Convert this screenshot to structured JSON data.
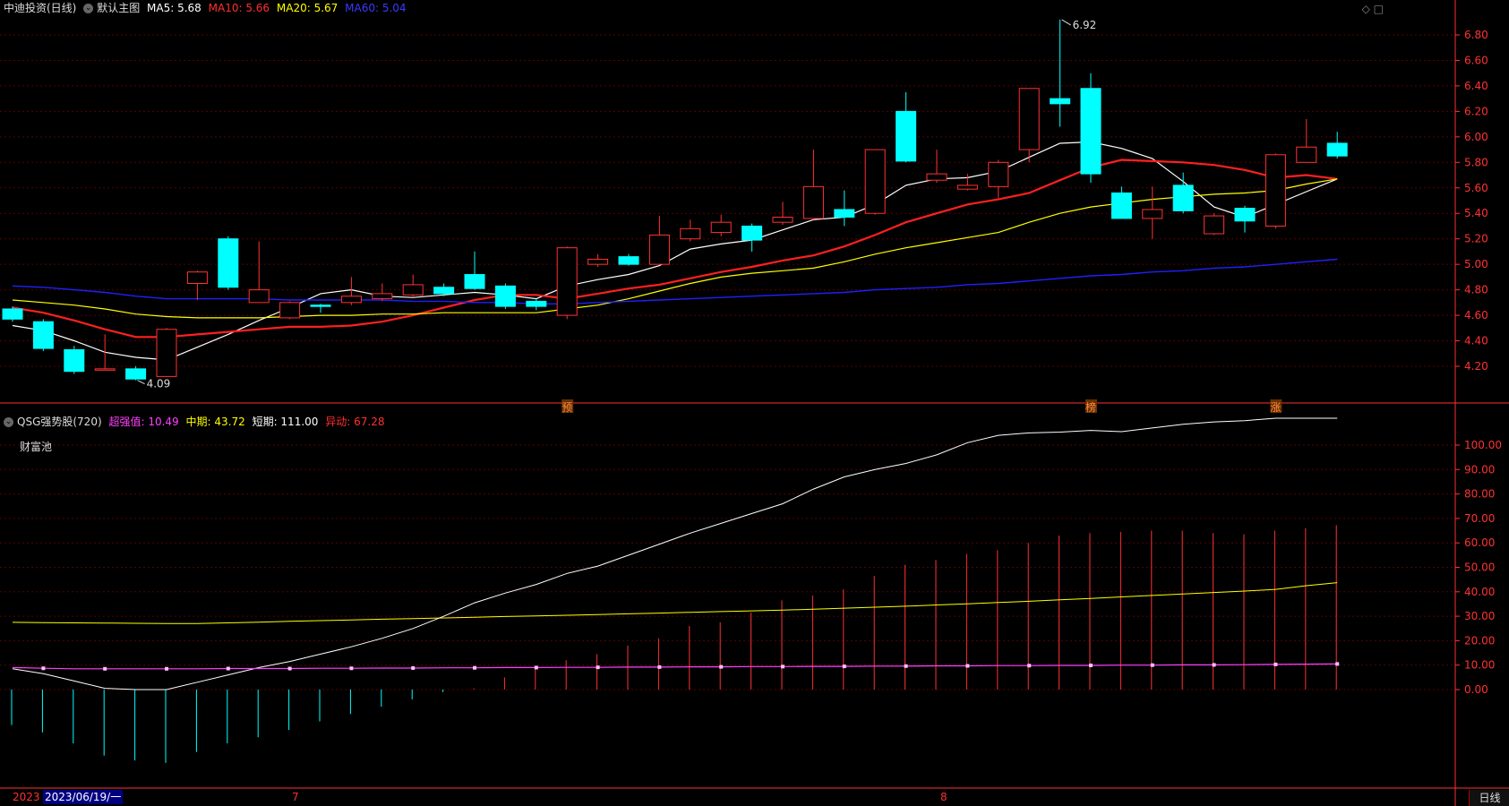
{
  "colors": {
    "up": "#ff3232",
    "down": "#00ffff",
    "ma5": "#ffffff",
    "ma10": "#ff2020",
    "ma20": "#ffff00",
    "ma60": "#2020ff",
    "ind_long": "#ff40ff",
    "ind_mid": "#ffff00",
    "ind_short": "#ffffff",
    "ind_move": "#ff3030",
    "grid": "#5a0000",
    "axis": "#ff3232"
  },
  "header": {
    "stock": "中迪投资(日线)",
    "main_label": "默认主图",
    "ma5": "MA5: 5.68",
    "ma10": "MA10: 5.66",
    "ma20": "MA20: 5.67",
    "ma60": "MA60: 5.04"
  },
  "indicator_header": {
    "name": "QSG强势股(720)",
    "long": "超强值: 10.49",
    "mid": "中期: 43.72",
    "short": "短期: 111.00",
    "move": "异动: 67.28"
  },
  "pool_label": "财富池",
  "period_tab": "日线",
  "date_axis": {
    "year": "2023",
    "cursor": "2023/06/19/一",
    "month7": "7",
    "month8": "8"
  },
  "markers": [
    {
      "text": "预",
      "index": 18
    },
    {
      "text": "榜",
      "index": 35
    },
    {
      "text": "涨",
      "index": 41
    }
  ],
  "annotations": {
    "high": "6.92",
    "low": "4.09"
  },
  "chart_data": [
    {
      "type": "candlestick",
      "title": "中迪投资(日线)",
      "ylim": [
        4.0,
        7.0
      ],
      "ticks": [
        "6.80",
        "6.60",
        "6.40",
        "6.20",
        "6.00",
        "5.80",
        "5.60",
        "5.40",
        "5.20",
        "5.00",
        "4.80",
        "4.60",
        "4.40",
        "4.20"
      ],
      "ohlc": [
        [
          4.65,
          4.67,
          4.55,
          4.57
        ],
        [
          4.55,
          4.57,
          4.32,
          4.34
        ],
        [
          4.33,
          4.36,
          4.14,
          4.16
        ],
        [
          4.18,
          4.45,
          4.18,
          4.18
        ],
        [
          4.18,
          4.2,
          4.09,
          4.1
        ],
        [
          4.12,
          4.5,
          4.12,
          4.49
        ],
        [
          4.85,
          4.95,
          4.72,
          4.94
        ],
        [
          5.2,
          5.22,
          4.8,
          4.82
        ],
        [
          4.7,
          5.18,
          4.7,
          4.8
        ],
        [
          4.58,
          4.71,
          4.57,
          4.7
        ],
        [
          4.68,
          4.69,
          4.62,
          4.67
        ],
        [
          4.7,
          4.9,
          4.68,
          4.75
        ],
        [
          4.73,
          4.85,
          4.71,
          4.77
        ],
        [
          4.76,
          4.92,
          4.74,
          4.84
        ],
        [
          4.82,
          4.85,
          4.75,
          4.77
        ],
        [
          4.92,
          5.1,
          4.8,
          4.81
        ],
        [
          4.83,
          4.85,
          4.65,
          4.67
        ],
        [
          4.71,
          4.73,
          4.64,
          4.67
        ],
        [
          4.6,
          5.14,
          4.57,
          5.13
        ],
        [
          5.0,
          5.08,
          4.98,
          5.04
        ],
        [
          5.06,
          5.08,
          4.99,
          5.0
        ],
        [
          5.0,
          5.38,
          5.0,
          5.23
        ],
        [
          5.2,
          5.35,
          5.18,
          5.28
        ],
        [
          5.25,
          5.39,
          5.22,
          5.33
        ],
        [
          5.3,
          5.32,
          5.1,
          5.19
        ],
        [
          5.33,
          5.49,
          5.31,
          5.37
        ],
        [
          5.36,
          5.9,
          5.35,
          5.61
        ],
        [
          5.43,
          5.58,
          5.3,
          5.37
        ],
        [
          5.4,
          5.9,
          5.39,
          5.9
        ],
        [
          6.2,
          6.35,
          5.8,
          5.81
        ],
        [
          5.66,
          5.9,
          5.64,
          5.71
        ],
        [
          5.59,
          5.71,
          5.58,
          5.62
        ],
        [
          5.61,
          5.82,
          5.52,
          5.8
        ],
        [
          5.9,
          6.38,
          5.8,
          6.38
        ],
        [
          6.3,
          6.92,
          6.08,
          6.26
        ],
        [
          6.38,
          6.5,
          5.64,
          5.71
        ],
        [
          5.56,
          5.61,
          5.36,
          5.36
        ],
        [
          5.36,
          5.61,
          5.2,
          5.43
        ],
        [
          5.62,
          5.72,
          5.4,
          5.42
        ],
        [
          5.24,
          5.4,
          5.23,
          5.38
        ],
        [
          5.44,
          5.46,
          5.25,
          5.34
        ],
        [
          5.3,
          5.87,
          5.28,
          5.86
        ],
        [
          5.8,
          6.14,
          5.8,
          5.92
        ],
        [
          5.95,
          6.04,
          5.83,
          5.85
        ]
      ],
      "series": [
        {
          "name": "MA5",
          "values": [
            4.52,
            4.48,
            4.4,
            4.31,
            4.27,
            4.25,
            4.35,
            4.45,
            4.56,
            4.66,
            4.77,
            4.8,
            4.75,
            4.74,
            4.76,
            4.78,
            4.76,
            4.73,
            4.83,
            4.88,
            4.92,
            4.99,
            5.12,
            5.16,
            5.19,
            5.27,
            5.35,
            5.37,
            5.47,
            5.62,
            5.67,
            5.68,
            5.73,
            5.84,
            5.95,
            5.96,
            5.91,
            5.83,
            5.65,
            5.45,
            5.37,
            5.47,
            5.57,
            5.67
          ]
        },
        {
          "name": "MA10",
          "values": [
            4.66,
            4.62,
            4.56,
            4.49,
            4.43,
            4.43,
            4.45,
            4.47,
            4.49,
            4.51,
            4.51,
            4.52,
            4.55,
            4.6,
            4.66,
            4.72,
            4.76,
            4.76,
            4.73,
            4.77,
            4.81,
            4.84,
            4.89,
            4.94,
            4.98,
            5.03,
            5.07,
            5.14,
            5.23,
            5.33,
            5.4,
            5.47,
            5.51,
            5.56,
            5.66,
            5.76,
            5.82,
            5.81,
            5.8,
            5.78,
            5.74,
            5.68,
            5.7,
            5.67
          ]
        },
        {
          "name": "MA20",
          "values": [
            4.72,
            4.7,
            4.68,
            4.65,
            4.61,
            4.59,
            4.58,
            4.58,
            4.58,
            4.59,
            4.6,
            4.6,
            4.61,
            4.61,
            4.62,
            4.62,
            4.62,
            4.62,
            4.65,
            4.68,
            4.73,
            4.79,
            4.85,
            4.9,
            4.93,
            4.95,
            4.97,
            5.02,
            5.08,
            5.13,
            5.17,
            5.21,
            5.25,
            5.33,
            5.4,
            5.45,
            5.48,
            5.51,
            5.53,
            5.55,
            5.56,
            5.58,
            5.63,
            5.67
          ]
        },
        {
          "name": "MA60",
          "values": [
            4.83,
            4.82,
            4.8,
            4.78,
            4.75,
            4.73,
            4.73,
            4.73,
            4.73,
            4.72,
            4.72,
            4.72,
            4.72,
            4.71,
            4.71,
            4.7,
            4.7,
            4.69,
            4.69,
            4.7,
            4.71,
            4.72,
            4.73,
            4.74,
            4.75,
            4.76,
            4.77,
            4.78,
            4.8,
            4.81,
            4.82,
            4.84,
            4.85,
            4.87,
            4.89,
            4.91,
            4.92,
            4.94,
            4.95,
            4.97,
            4.98,
            5.0,
            5.02,
            5.04
          ]
        }
      ]
    },
    {
      "type": "bar",
      "title": "QSG强势股(720)",
      "ylim": [
        -30,
        110
      ],
      "ticks": [
        "100.00",
        "90.00",
        "80.00",
        "70.00",
        "60.00",
        "50.00",
        "40.00",
        "30.00",
        "20.00",
        "10.00",
        "0.00"
      ],
      "series": [
        {
          "name": "超强值",
          "values": [
            9.0,
            8.7,
            8.5,
            8.5,
            8.5,
            8.5,
            8.5,
            8.6,
            8.6,
            8.6,
            8.7,
            8.7,
            8.8,
            8.8,
            8.9,
            8.9,
            9.0,
            9.0,
            9.1,
            9.1,
            9.2,
            9.2,
            9.3,
            9.3,
            9.4,
            9.4,
            9.5,
            9.5,
            9.6,
            9.6,
            9.7,
            9.7,
            9.8,
            9.8,
            9.9,
            9.9,
            10.0,
            10.0,
            10.1,
            10.1,
            10.2,
            10.3,
            10.4,
            10.49
          ]
        },
        {
          "name": "中期",
          "values": [
            27.5,
            27.4,
            27.3,
            27.2,
            27.1,
            27.0,
            27.0,
            27.3,
            27.6,
            27.9,
            28.2,
            28.5,
            28.8,
            29.0,
            29.3,
            29.6,
            29.9,
            30.1,
            30.4,
            30.7,
            31.0,
            31.3,
            31.6,
            31.9,
            32.2,
            32.5,
            32.9,
            33.3,
            33.7,
            34.1,
            34.6,
            35.1,
            35.6,
            36.1,
            36.7,
            37.3,
            37.9,
            38.5,
            39.1,
            39.7,
            40.3,
            41.0,
            42.5,
            43.72
          ]
        },
        {
          "name": "短期",
          "values": [
            8.5,
            6.5,
            3.5,
            0.5,
            0.0,
            0.0,
            3.0,
            6.0,
            9.0,
            11.5,
            14.5,
            17.5,
            21.0,
            25.0,
            30.0,
            35.5,
            39.5,
            43.0,
            47.5,
            50.5,
            55.0,
            59.5,
            64.0,
            68.0,
            72.0,
            76.0,
            82.0,
            87.0,
            90.0,
            92.5,
            96.0,
            101.0,
            104.0,
            105.0,
            105.3,
            106.0,
            105.5,
            107.0,
            108.5,
            109.5,
            110.0,
            111.0,
            111.0,
            111.0
          ]
        },
        {
          "name": "异动",
          "values": [
            -14.5,
            -17.5,
            -22.0,
            -27.0,
            -29.0,
            -30.0,
            -25.5,
            -22.0,
            -19.5,
            -16.5,
            -13.0,
            -10.0,
            -7.0,
            -4.0,
            -1.0,
            0.5,
            5.0,
            9.5,
            12.0,
            14.5,
            18.0,
            21.0,
            26.0,
            27.5,
            31.5,
            36.5,
            38.5,
            41.0,
            46.5,
            51.0,
            53.0,
            55.5,
            57.0,
            60.0,
            63.0,
            64.0,
            64.5,
            65.0,
            65.0,
            64.0,
            63.5,
            65.0,
            66.0,
            67.28
          ]
        }
      ]
    }
  ]
}
